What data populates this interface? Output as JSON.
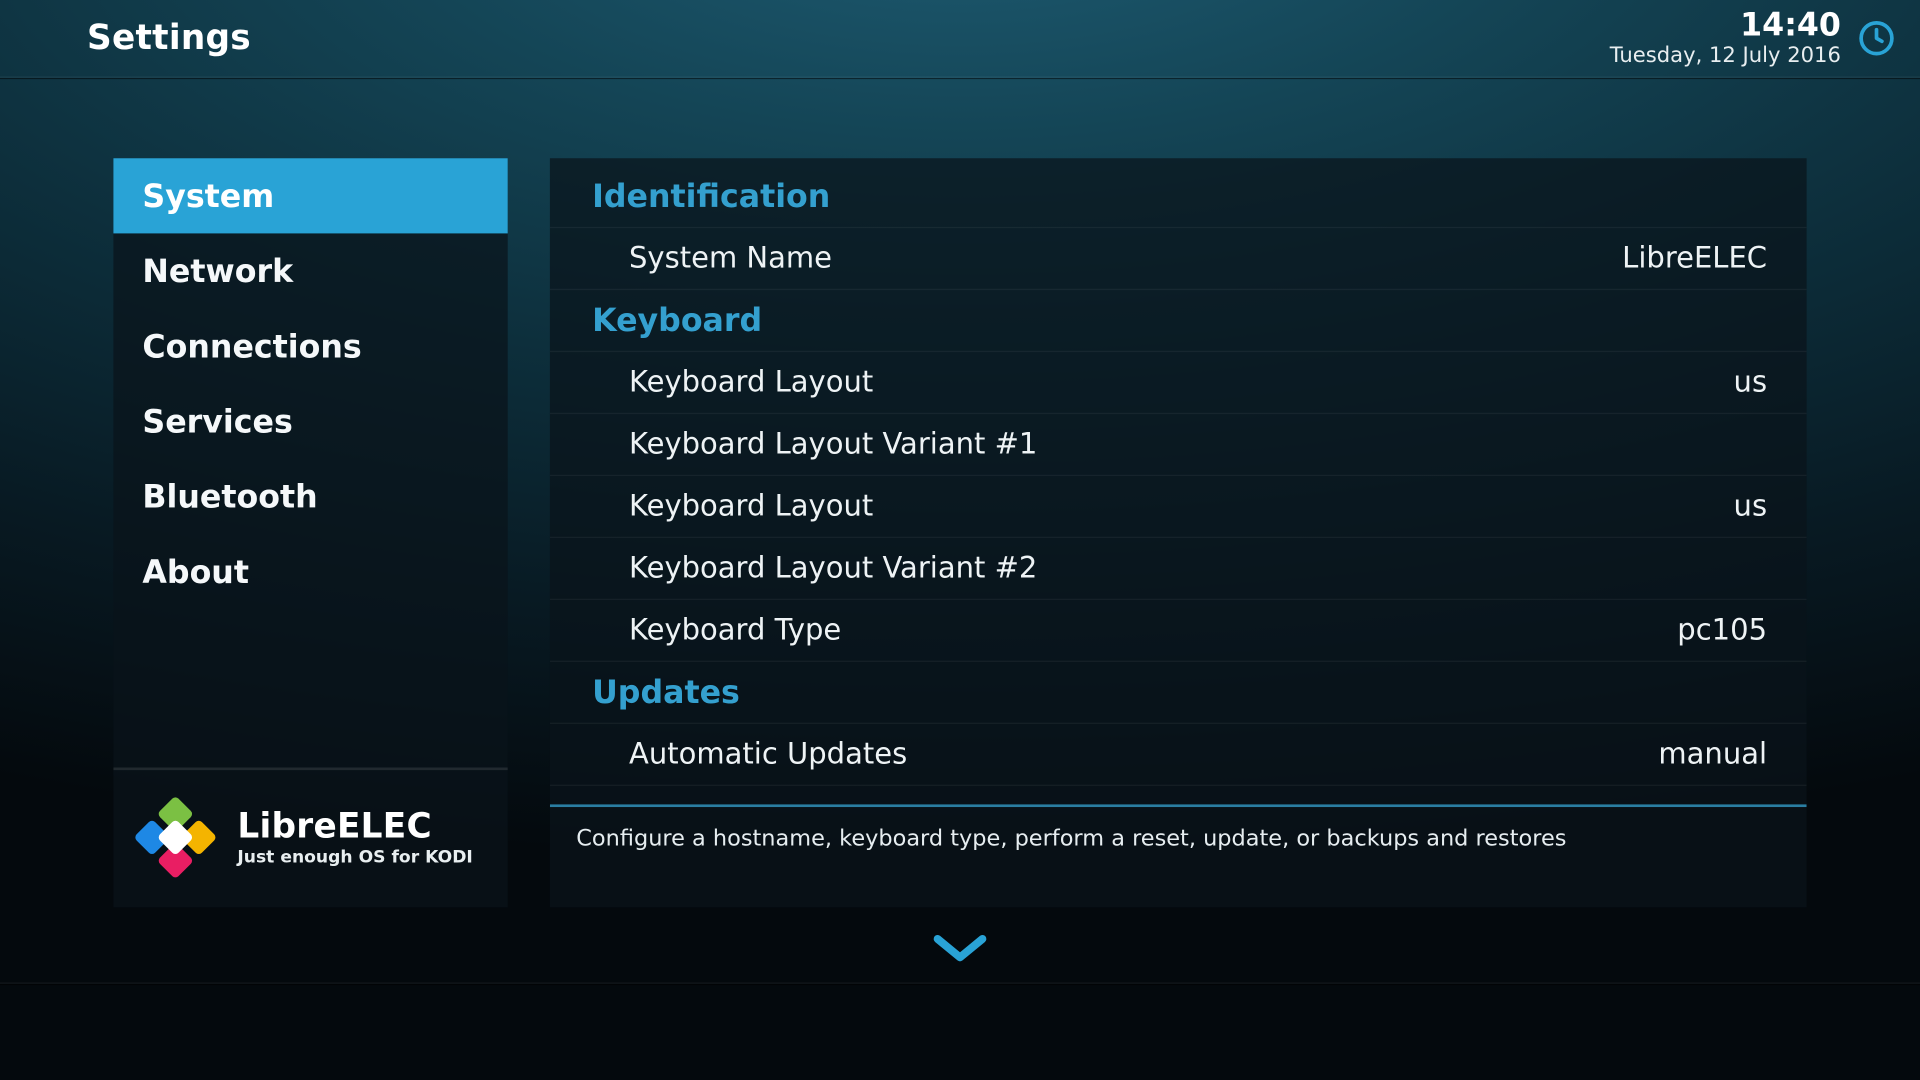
{
  "colors": {
    "accent": "#29a3d6",
    "section_heading": "#34a0cf",
    "panel_bg": "rgba(10,20,26,0.72)"
  },
  "header": {
    "title": "Settings",
    "time": "14:40",
    "date": "Tuesday, 12 July 2016"
  },
  "sidebar": {
    "items": [
      {
        "label": "System",
        "selected": true
      },
      {
        "label": "Network",
        "selected": false
      },
      {
        "label": "Connections",
        "selected": false
      },
      {
        "label": "Services",
        "selected": false
      },
      {
        "label": "Bluetooth",
        "selected": false
      },
      {
        "label": "About",
        "selected": false
      }
    ]
  },
  "logo": {
    "name": "LibreELEC",
    "tagline": "Just enough OS for KODI"
  },
  "settings": {
    "groups": [
      {
        "title": "Identification",
        "rows": [
          {
            "label": "System Name",
            "value": "LibreELEC"
          }
        ]
      },
      {
        "title": "Keyboard",
        "rows": [
          {
            "label": "Keyboard Layout",
            "value": "us"
          },
          {
            "label": "Keyboard Layout Variant #1",
            "value": ""
          },
          {
            "label": "Keyboard Layout",
            "value": "us"
          },
          {
            "label": "Keyboard Layout Variant #2",
            "value": ""
          },
          {
            "label": "Keyboard Type",
            "value": "pc105"
          }
        ]
      },
      {
        "title": "Updates",
        "rows": [
          {
            "label": "Automatic Updates",
            "value": "manual"
          }
        ]
      }
    ],
    "description": "Configure a hostname, keyboard type, perform a reset, update, or backups and restores"
  }
}
